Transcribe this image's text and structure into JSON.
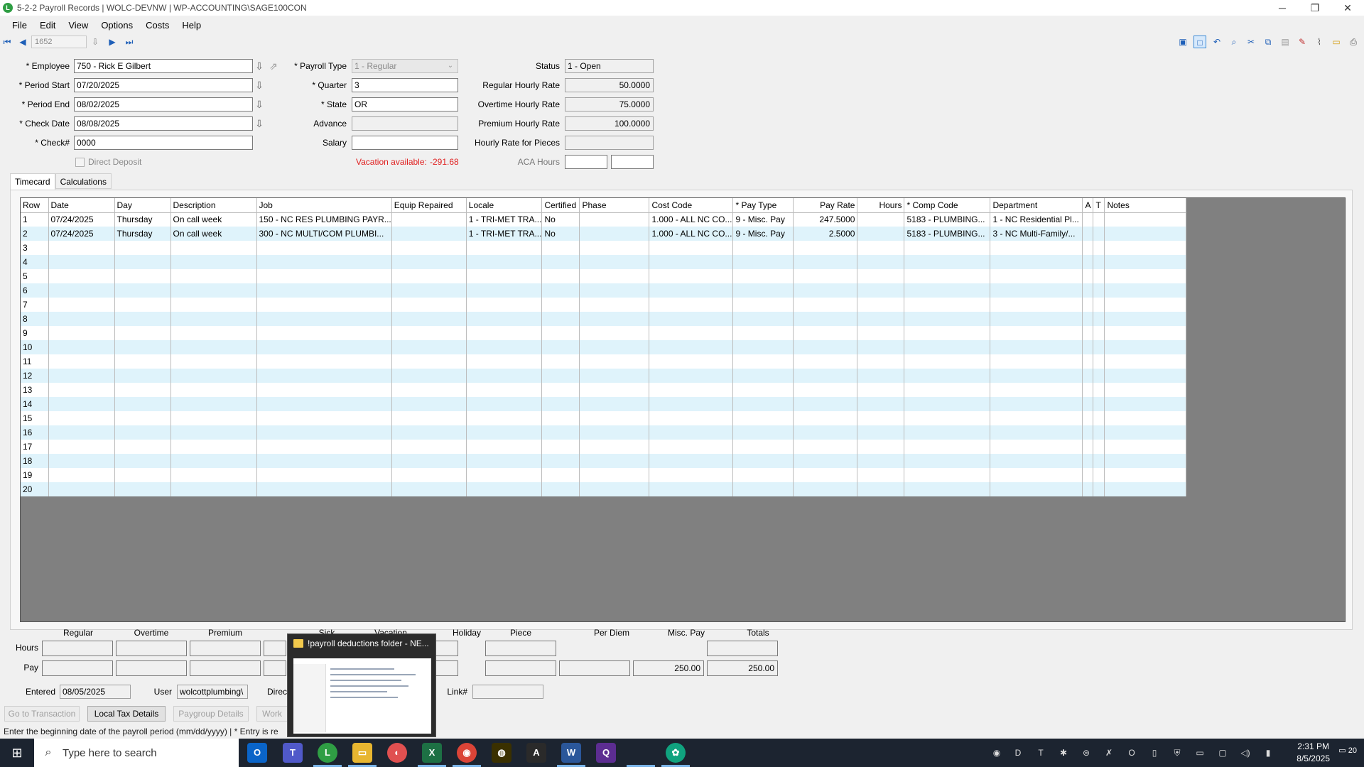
{
  "window": {
    "title": "5-2-2 Payroll Records  |  WOLC-DEVNW  |  WP-ACCOUNTING\\SAGE100CON",
    "app_icon_letter": "L"
  },
  "menu": [
    "File",
    "Edit",
    "View",
    "Options",
    "Costs",
    "Help"
  ],
  "toolbar": {
    "record_number": "1652"
  },
  "form": {
    "employee_label": "* Employee",
    "employee": "750 - Rick E Gilbert",
    "period_start_label": "* Period Start",
    "period_start": "07/20/2025",
    "period_end_label": "* Period End",
    "period_end": "08/02/2025",
    "check_date_label": "* Check Date",
    "check_date": "08/08/2025",
    "check_num_label": "* Check#",
    "check_num": "0000",
    "direct_deposit_label": "Direct Deposit",
    "payroll_type_label": "* Payroll Type",
    "payroll_type": "1 - Regular",
    "quarter_label": "* Quarter",
    "quarter": "3",
    "state_label": "* State",
    "state": "OR",
    "advance_label": "Advance",
    "advance": "",
    "salary_label": "Salary",
    "salary": "",
    "vacation_label": "Vacation available:",
    "vacation_value": "-291.68",
    "status_label": "Status",
    "status": "1 - Open",
    "regular_rate_label": "Regular Hourly Rate",
    "regular_rate": "50.0000",
    "overtime_rate_label": "Overtime Hourly Rate",
    "overtime_rate": "75.0000",
    "premium_rate_label": "Premium Hourly Rate",
    "premium_rate": "100.0000",
    "pieces_rate_label": "Hourly Rate for Pieces",
    "pieces_rate": "",
    "aca_label": "ACA Hours"
  },
  "tabs": [
    "Timecard",
    "Calculations"
  ],
  "grid": {
    "columns": [
      "Row",
      "Date",
      "Day",
      "Description",
      "Job",
      "Equip Repaired",
      "Locale",
      "Certified",
      "Phase",
      "Cost Code",
      "* Pay Type",
      "Pay Rate",
      "Hours",
      "* Comp Code",
      "Department",
      "A",
      "T",
      "Notes"
    ],
    "rows": [
      [
        "1",
        "07/24/2025",
        "Thursday",
        "On call week",
        "150 - NC RES PLUMBING PAYR...",
        "",
        "1 - TRI-MET TRA...",
        "No",
        "",
        "1.000 - ALL NC CO...",
        "9 - Misc. Pay",
        "247.5000",
        "",
        "5183 - PLUMBING...",
        "1 - NC Residential Pl...",
        "",
        "",
        ""
      ],
      [
        "2",
        "07/24/2025",
        "Thursday",
        "On call week",
        "300 - NC MULTI/COM PLUMBI...",
        "",
        "1 - TRI-MET TRA...",
        "No",
        "",
        "1.000 - ALL NC CO...",
        "9 - Misc. Pay",
        "2.5000",
        "",
        "5183 - PLUMBING...",
        "3 - NC Multi-Family/...",
        "",
        "",
        ""
      ],
      [
        "3"
      ],
      [
        "4"
      ],
      [
        "5"
      ],
      [
        "6"
      ],
      [
        "7"
      ],
      [
        "8"
      ],
      [
        "9"
      ],
      [
        "10"
      ],
      [
        "11"
      ],
      [
        "12"
      ],
      [
        "13"
      ],
      [
        "14"
      ],
      [
        "15"
      ],
      [
        "16"
      ],
      [
        "17"
      ],
      [
        "18"
      ],
      [
        "19"
      ],
      [
        "20"
      ]
    ]
  },
  "totals": {
    "headers": [
      "Regular",
      "Overtime",
      "Premium",
      "Sick",
      "Vacation",
      "Holiday",
      "Piece",
      "Per Diem",
      "Misc. Pay",
      "Totals"
    ],
    "hours_label": "Hours",
    "pay_label": "Pay",
    "misc_pay": "250.00",
    "total_pay": "250.00"
  },
  "footer": {
    "entered_label": "Entered",
    "entered": "08/05/2025",
    "user_label": "User",
    "user": "wolcottplumbing\\",
    "direct_label": "Direc",
    "link_label": "Link#",
    "link": "",
    "btn_go_transaction": "Go to Transaction",
    "btn_local_tax": "Local Tax Details",
    "btn_paygroup": "Paygroup Details",
    "btn_work": "Work"
  },
  "status_bar": "Enter the beginning date of the payroll period (mm/dd/yyyy)  |  * Entry is re",
  "popup": {
    "title": "!payroll deductions folder - NE..."
  },
  "taskbar": {
    "search_placeholder": "Type here to search",
    "time": "2:31 PM",
    "date": "8/5/2025",
    "notifications": "20"
  },
  "colors": {
    "accent": "#1e5fb8",
    "alert": "#e02020",
    "row_alt": "#dff3fb",
    "grid_bg": "#808080"
  }
}
